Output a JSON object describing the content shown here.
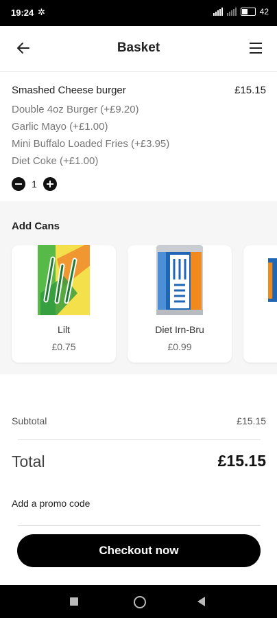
{
  "status_bar": {
    "time": "19:24",
    "battery": "42"
  },
  "header": {
    "title": "Basket"
  },
  "basket_item": {
    "name": "Smashed Cheese burger",
    "price": "£15.15",
    "options": [
      "Double 4oz Burger (+£9.20)",
      "Garlic Mayo (+£1.00)",
      "Mini Buffalo Loaded Fries (+£3.95)",
      "Diet Coke (+£1.00)"
    ],
    "quantity": "1"
  },
  "add_cans": {
    "title": "Add Cans",
    "cards": [
      {
        "name": "Lilt",
        "price": "£0.75"
      },
      {
        "name": "Diet Irn-Bru",
        "price": "£0.99"
      }
    ]
  },
  "summary": {
    "subtotal_label": "Subtotal",
    "subtotal_value": "£15.15",
    "total_label": "Total",
    "total_value": "£15.15",
    "promo_label": "Add a promo code"
  },
  "checkout": {
    "label": "Checkout now"
  },
  "colors": {
    "primary": "#000000",
    "panel": "#f6f6f6",
    "muted_text": "#777777"
  }
}
